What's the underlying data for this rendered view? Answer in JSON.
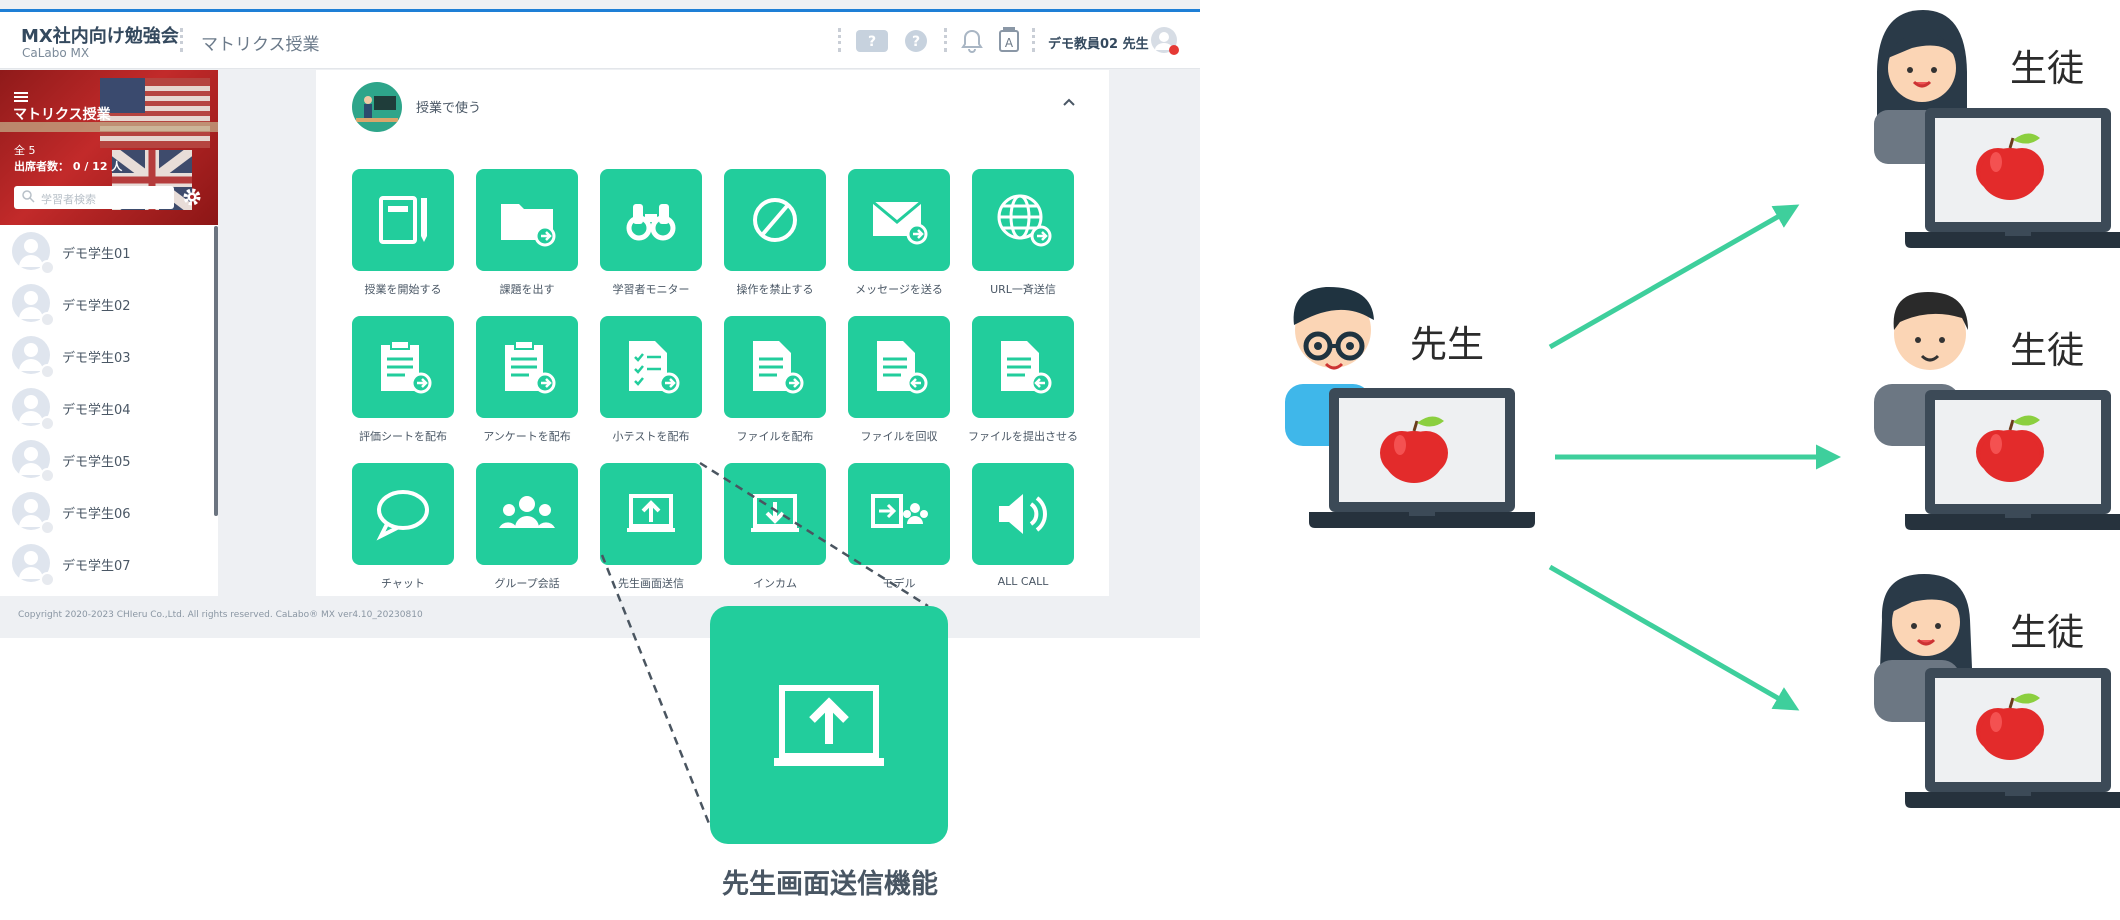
{
  "app": {
    "title": "MX社内向け勉強会",
    "subtitle": "CaLabo MX",
    "page_title": "マトリクス授業",
    "user": "デモ教員02 先生",
    "help_badge": "?",
    "lang_badge": "A"
  },
  "sidebar": {
    "class_title": "マトリクス授業",
    "count": "全 5",
    "attendance": "出席者数： 0 / 12 人",
    "search_placeholder": "学習者検索",
    "students": [
      "デモ学生01",
      "デモ学生02",
      "デモ学生03",
      "デモ学生04",
      "デモ学生05",
      "デモ学生06",
      "デモ学生07"
    ]
  },
  "panel": {
    "section_label": "授業で使う",
    "tiles": [
      {
        "label": "授業を開始する",
        "icon": "notebook-pen-icon"
      },
      {
        "label": "課題を出す",
        "icon": "folder-arrow-icon"
      },
      {
        "label": "学習者モニター",
        "icon": "binoculars-icon"
      },
      {
        "label": "操作を禁止する",
        "icon": "prohibit-icon"
      },
      {
        "label": "メッセージを送る",
        "icon": "envelope-icon"
      },
      {
        "label": "URL一斉送信",
        "icon": "globe-icon"
      },
      {
        "label": "評価シートを配布",
        "icon": "clipboard-icon"
      },
      {
        "label": "アンケートを配布",
        "icon": "survey-clipboard-icon"
      },
      {
        "label": "小テストを配布",
        "icon": "checklist-doc-icon"
      },
      {
        "label": "ファイルを配布",
        "icon": "file-send-icon"
      },
      {
        "label": "ファイルを回収",
        "icon": "file-collect-icon"
      },
      {
        "label": "ファイルを提出させる",
        "icon": "file-submit-icon"
      },
      {
        "label": "チャット",
        "icon": "chat-bubble-icon"
      },
      {
        "label": "グループ会話",
        "icon": "group-icon"
      },
      {
        "label": "先生画面送信",
        "icon": "screen-upload-icon"
      },
      {
        "label": "インカム",
        "icon": "screen-download-icon"
      },
      {
        "label": "モデル",
        "icon": "model-icon"
      },
      {
        "label": "ALL CALL",
        "icon": "speaker-icon"
      }
    ]
  },
  "footer": {
    "copyright": "Copyright 2020-2023 CHIeru Co.,Ltd. All rights reserved. CaLabo® MX ver4.10_20230810"
  },
  "callout": {
    "caption": "先生画面送信機能"
  },
  "diagram": {
    "teacher_label": "先生",
    "student_label": "生徒",
    "accent": "#3ecf9c"
  }
}
